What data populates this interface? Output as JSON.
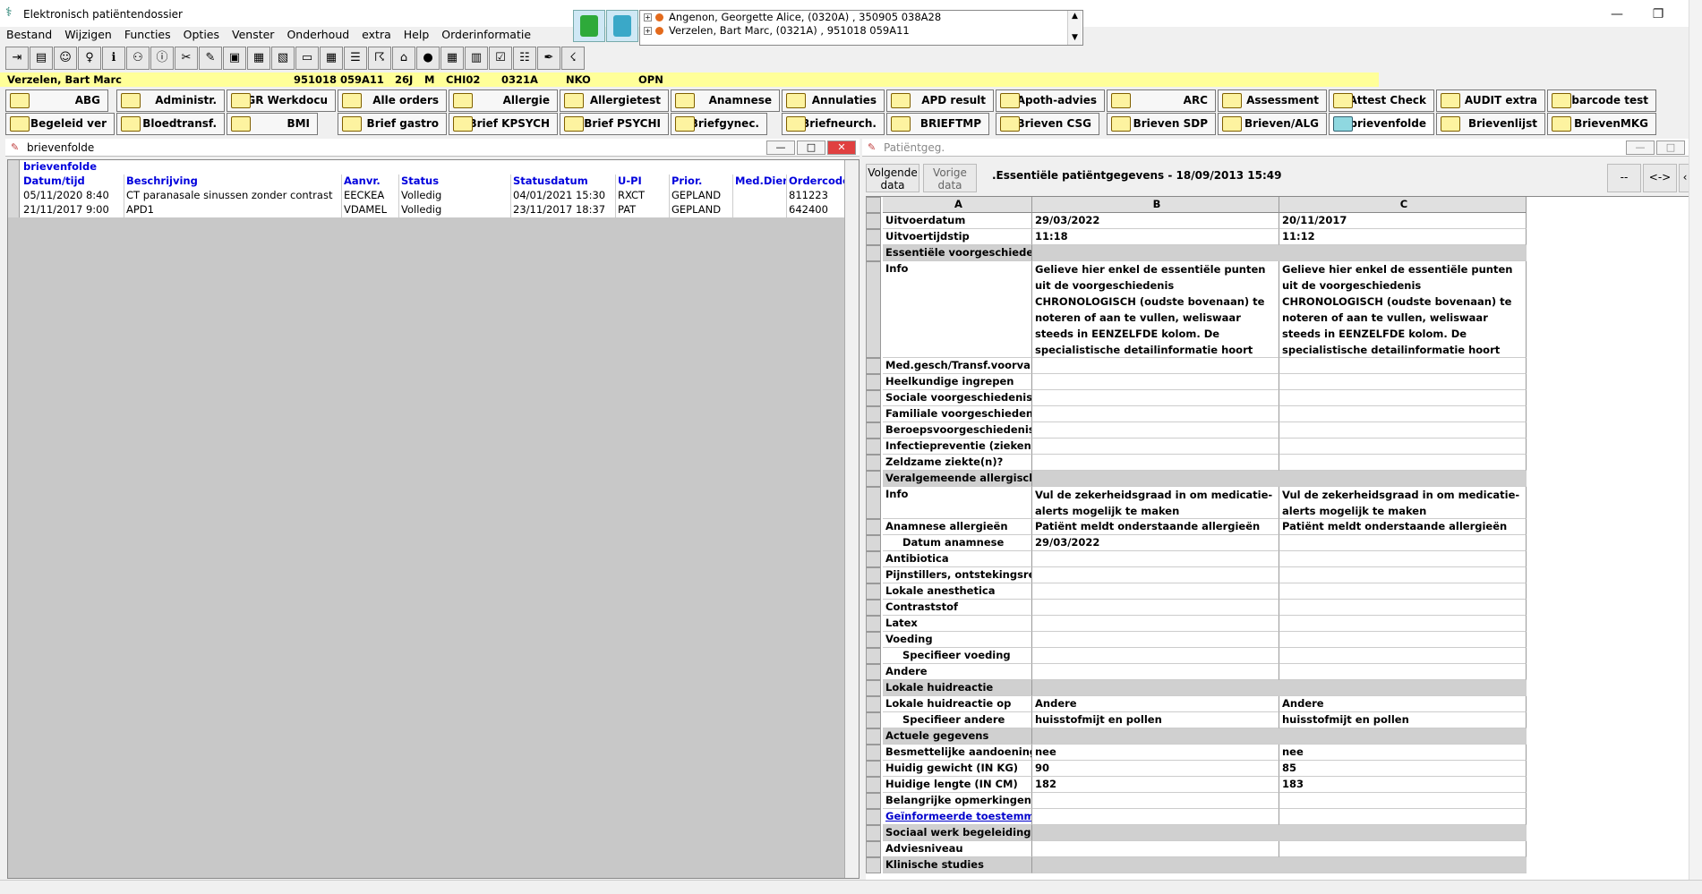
{
  "window": {
    "title": "Elektronisch patiëntendossier"
  },
  "menu": [
    "Bestand",
    "Wijzigen",
    "Functies",
    "Opties",
    "Venster",
    "Onderhoud",
    "extra",
    "Help",
    "Orderinformatie"
  ],
  "patients": [
    {
      "text": "Angenon,  Georgette Alice,  (0320A) ,  350905 038A28"
    },
    {
      "text": "Verzelen,  Bart Marc,  (0321A) ,  951018 059A11"
    }
  ],
  "patbar": {
    "name": "Verzelen,  Bart Marc",
    "id": "951018 059A11",
    "age": "26J",
    "sex": "M",
    "unit": "CHI02",
    "room": "0321A",
    "dept": "NKO",
    "status": "OPN"
  },
  "tabs_row1": [
    "ABG",
    "Administr.",
    "AGR Werkdocu",
    "Alle orders",
    "Allergie",
    "Allergietest",
    "Anamnese",
    "Annulaties",
    "APD result",
    "Apoth-advies",
    "ARC",
    "Assessment",
    "Attest Check",
    "AUDIT extra",
    "barcode test"
  ],
  "tabs_row2": [
    "Begeleid ver",
    "Bloedtransf.",
    "BMI",
    "Brief gastro",
    "Brief KPSYCH",
    "Brief PSYCHI",
    "Briefgynec.",
    "Briefneurch.",
    "BRIEFTMP",
    "Brieven CSG",
    "Brieven SDP",
    "Brieven/ALG",
    "brievenfolde",
    "Brievenlijst",
    "BrievenMKG"
  ],
  "left_panel": {
    "title": "brievenfolde",
    "group_label": "brievenfolde",
    "headers": [
      "Datum/tijd",
      "Beschrijving",
      "Aanvr.",
      "Status",
      "Statusdatum",
      "U-PI",
      "Prior.",
      "Med.Dien",
      "Ordercode"
    ],
    "rows": [
      [
        "05/11/2020 8:40",
        "CT paranasale sinussen zonder contrast",
        "EECKEA",
        "Volledig",
        "04/01/2021 15:30",
        "RXCT",
        "GEPLAND",
        "",
        "811223"
      ],
      [
        "21/11/2017 9:00",
        "APD1",
        "VDAMEL",
        "Volledig",
        "23/11/2017 18:37",
        "PAT",
        "GEPLAND",
        "",
        "642400"
      ]
    ]
  },
  "right_panel": {
    "title": "Patiëntgeg.",
    "next_label": "Volgende data",
    "prev_label": "Vorige data",
    "form_title": ".Essentiële patiëntgegevens - 18/09/2013 15:49",
    "btn_dash": "--",
    "btn_arrows": "<->",
    "col_headers": [
      "A",
      "B",
      "C"
    ],
    "info_text": "Gelieve hier enkel de essentiële punten uit de voorgeschiedenis CHRONOLOGISCH (oudste bovenaan) te noteren of aan te vullen, weliswaar steeds in EENZELFDE kolom. De specialistische detailinformatie hoort thuis in het diensteigen dossier.",
    "allergy_info": "Vul de zekerheidsgraad in om medicatie-alerts mogelijk te maken",
    "rows": [
      {
        "a": "Uitvoerdatum",
        "b": "29/03/2022",
        "c": "20/11/2017"
      },
      {
        "a": "Uitvoertijdstip",
        "b": "11:18",
        "c": "11:12"
      },
      {
        "a": "Essentiële voorgeschiedenis",
        "section": true
      },
      {
        "a": "Med.gesch/Transf.voorval"
      },
      {
        "a": "Heelkundige ingrepen"
      },
      {
        "a": "Sociale voorgeschiedenis"
      },
      {
        "a": "Familiale voorgeschiedenis"
      },
      {
        "a": "Beroepsvoorgeschiedenis"
      },
      {
        "a": "Infectiepreventie (ziekenhuis"
      },
      {
        "a": "Zeldzame ziekte(n)?"
      },
      {
        "a": "Veralgemeende allergische r",
        "section": true
      },
      {
        "a": "Anamnese allergieën",
        "b": "Patiënt meldt onderstaande allergieën",
        "c": "Patiënt meldt onderstaande allergieën"
      },
      {
        "a": "Datum anamnese",
        "b": "29/03/2022",
        "c": ""
      },
      {
        "a": "Antibiotica"
      },
      {
        "a": "Pijnstillers, ontstekingsremme"
      },
      {
        "a": "Lokale anesthetica"
      },
      {
        "a": "Contraststof"
      },
      {
        "a": "Latex"
      },
      {
        "a": "Voeding"
      },
      {
        "a": "Specifieer voeding"
      },
      {
        "a": "Andere"
      },
      {
        "a": "Lokale huidreactie",
        "section": true
      },
      {
        "a": "Lokale huidreactie op",
        "b": "Andere",
        "c": "Andere"
      },
      {
        "a": "Specifieer andere",
        "b": "huisstofmijt en pollen",
        "c": "huisstofmijt en pollen"
      },
      {
        "a": "Actuele gegevens",
        "section": true
      },
      {
        "a": "Besmettelijke aandoeningen",
        "b": "nee",
        "c": "nee"
      },
      {
        "a": "Huidig gewicht (IN KG)",
        "b": "90",
        "c": "85"
      },
      {
        "a": "Huidige lengte (IN CM)",
        "b": "182",
        "c": "183"
      },
      {
        "a": "Belangrijke opmerkingen"
      },
      {
        "a": "Geïnformeerde toestemming",
        "link": true
      },
      {
        "a": "Sociaal werk begeleidingsad",
        "section": true
      },
      {
        "a": "Adviesniveau"
      },
      {
        "a": "Klinische studies",
        "section": true
      }
    ],
    "info_label": "Info"
  }
}
